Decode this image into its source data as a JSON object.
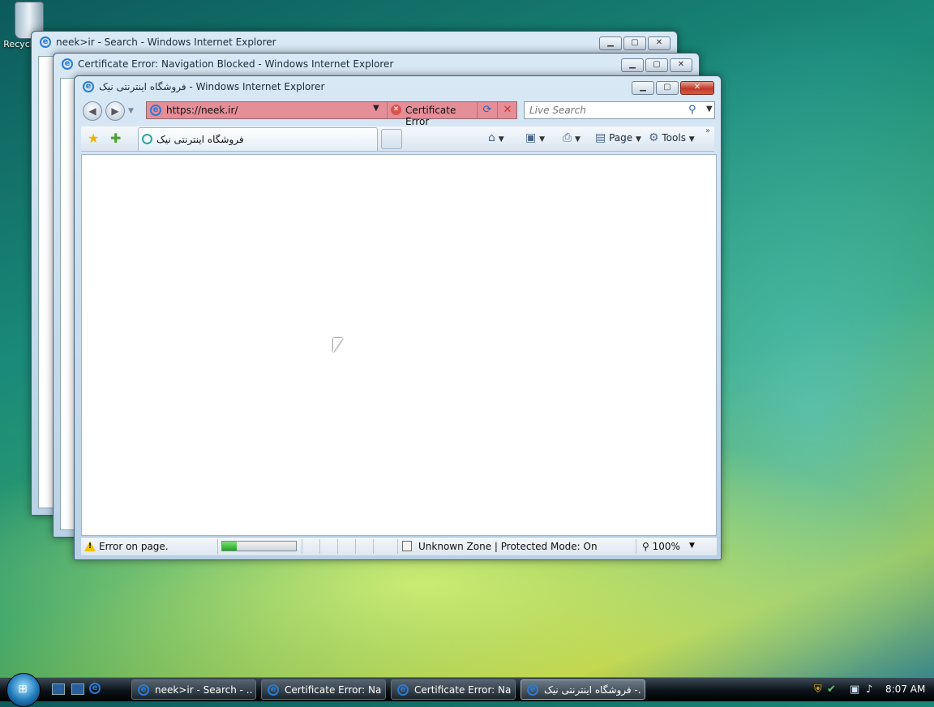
{
  "desktop": {
    "recycle_bin_label": "Recycle Bin"
  },
  "windows": {
    "back": {
      "title": "neek>ir - Search - Windows Internet Explorer",
      "controls": {
        "minimize": "▁",
        "maximize": "▢",
        "close": "✕"
      }
    },
    "middle": {
      "title": "Certificate Error: Navigation Blocked - Windows Internet Explorer",
      "controls": {
        "minimize": "▁",
        "maximize": "▢",
        "close": "✕"
      }
    },
    "front": {
      "title": "فروشگاه اینترنتی نیک - Windows Internet Explorer",
      "controls": {
        "minimize": "▁",
        "maximize": "▢",
        "close": "✕"
      },
      "address": {
        "url": "https://neek.ir/",
        "certificate_error_label": "Certificate Error",
        "status_color": "#e58e98"
      },
      "search": {
        "placeholder": "Live Search"
      },
      "tab": {
        "label": "فروشگاه اینترنتی نیک"
      },
      "command_bar": {
        "page_label": "Page",
        "tools_label": "Tools"
      },
      "status_bar": {
        "status_text": "Error on page.",
        "progress_fraction": 0.2,
        "zone_text": "Unknown Zone | Protected Mode: On",
        "zoom_text": "100%"
      }
    }
  },
  "taskbar": {
    "buttons": [
      {
        "label": "neek>ir - Search - ..."
      },
      {
        "label": "Certificate Error: Na..."
      },
      {
        "label": "Certificate Error: Na..."
      },
      {
        "label": "فروشگاه اینترنتی نیک -..."
      }
    ],
    "clock": "8:07 AM"
  }
}
